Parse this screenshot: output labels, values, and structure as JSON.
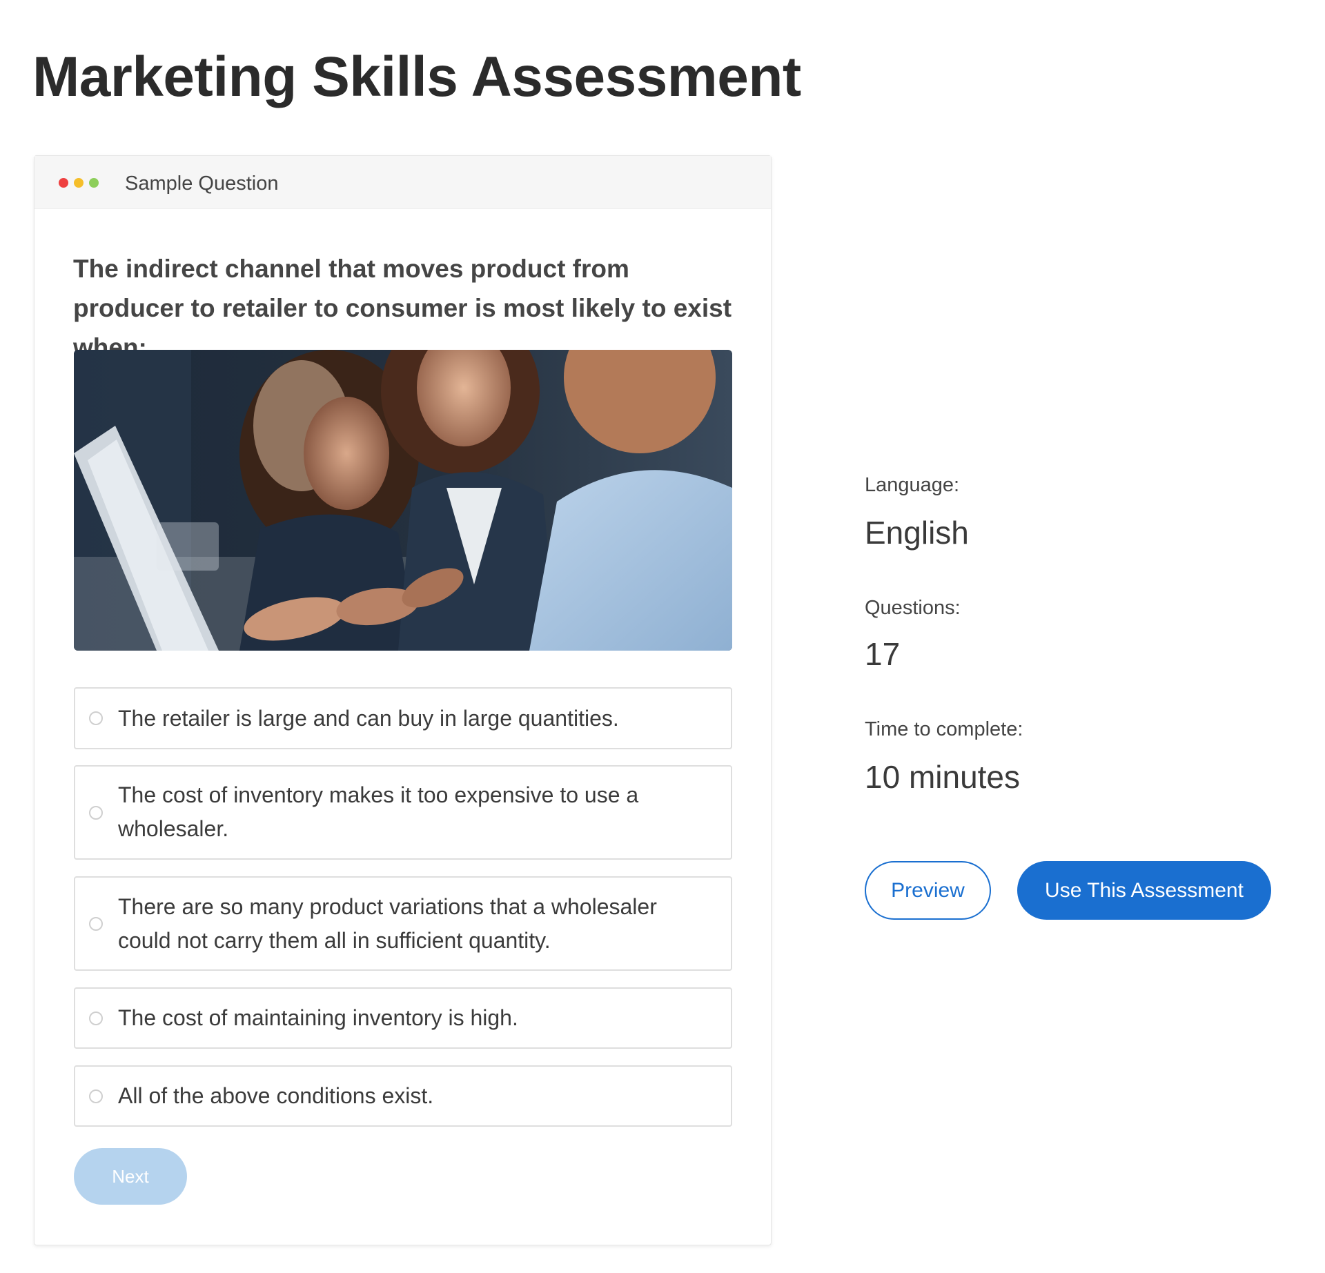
{
  "page": {
    "title": "Marketing Skills Assessment"
  },
  "sample_card": {
    "header_title": "Sample Question",
    "window_dots": [
      "#ee4040",
      "#f5be2a",
      "#8dce5a"
    ],
    "question": "The indirect channel that moves product from producer to retailer to consumer is most likely to exist when:",
    "options": [
      {
        "label": "The retailer is large and can buy in large quantities.",
        "selected": false
      },
      {
        "label": "The cost of inventory makes it too expensive to use a wholesaler.",
        "selected": false
      },
      {
        "label": "There are so many product variations that a wholesaler could not carry them all in sufficient quantity.",
        "selected": false
      },
      {
        "label": "The cost of maintaining inventory is high.",
        "selected": false
      },
      {
        "label": "All of the above conditions exist.",
        "selected": false
      }
    ],
    "next_label": "Next"
  },
  "details": {
    "language_label": "Language:",
    "language_value": "English",
    "questions_label": "Questions:",
    "questions_value": "17",
    "time_label": "Time to complete:",
    "time_value": "10 minutes"
  },
  "actions": {
    "preview_label": "Preview",
    "use_label": "Use This Assessment"
  },
  "colors": {
    "primary": "#1a6fd0",
    "next_disabled": "#b5d3ee"
  }
}
